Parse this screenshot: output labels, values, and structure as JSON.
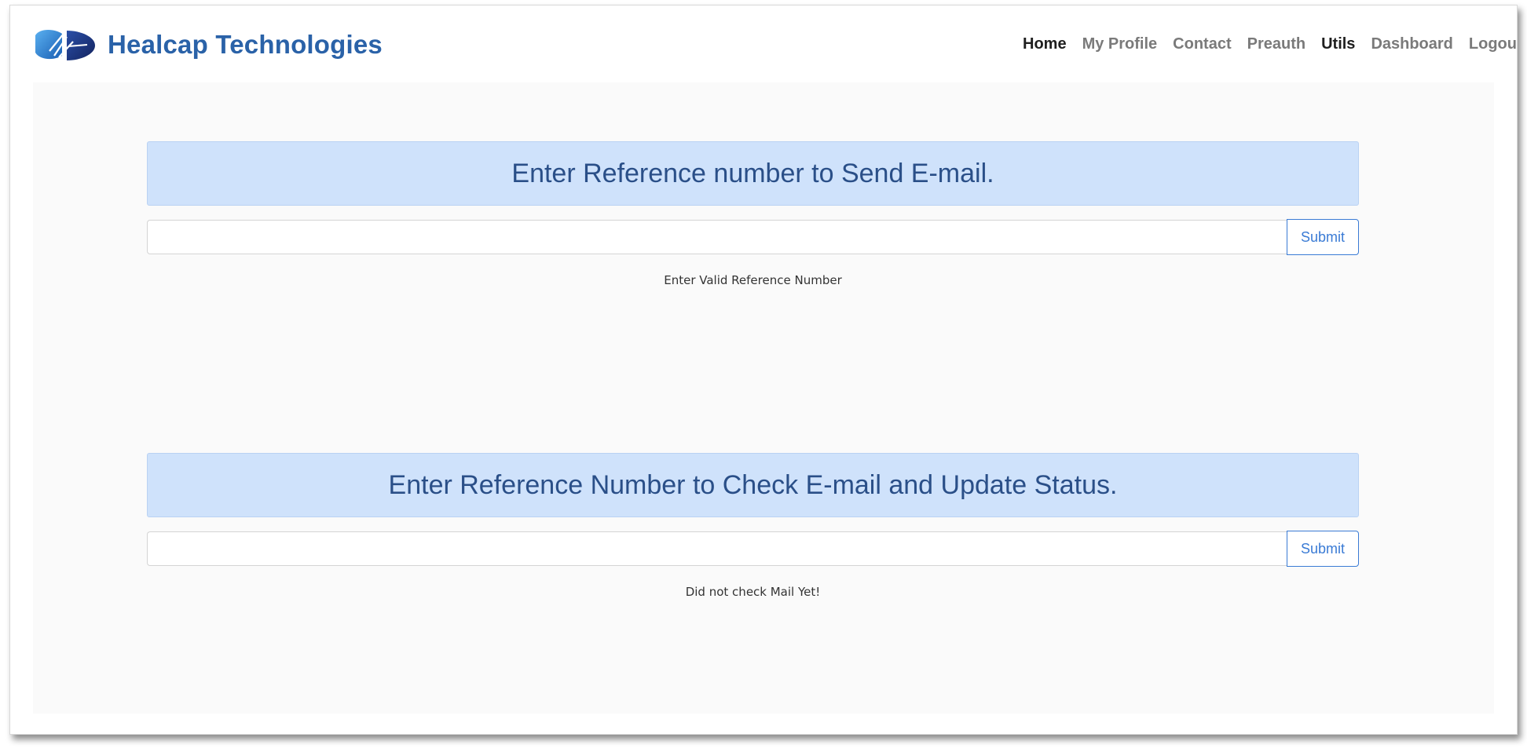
{
  "brand": {
    "name": "Healcap Technologies",
    "logo_icon": "healcap-logo-icon",
    "color": "#2a62a8"
  },
  "nav": {
    "items": [
      {
        "label": "Home",
        "active": true
      },
      {
        "label": "My Profile",
        "active": false
      },
      {
        "label": "Contact",
        "active": false
      },
      {
        "label": "Preauth",
        "active": false
      },
      {
        "label": "Utils",
        "active": true
      },
      {
        "label": "Dashboard",
        "active": false
      },
      {
        "label": "Logou",
        "active": false
      }
    ]
  },
  "send_email": {
    "title": "Enter Reference number to Send E-mail.",
    "input_value": "",
    "input_placeholder": "",
    "submit_label": "Submit",
    "status": "Enter Valid Reference Number"
  },
  "check_email": {
    "title": "Enter Reference Number to Check E-mail and Update Status.",
    "input_value": "",
    "input_placeholder": "",
    "submit_label": "Submit",
    "status": "Did not check Mail Yet!"
  },
  "colors": {
    "header_bg": "#cfe2fb",
    "header_text": "#2a4f88",
    "button_accent": "#3a7bd5",
    "content_bg": "#fafafa"
  }
}
